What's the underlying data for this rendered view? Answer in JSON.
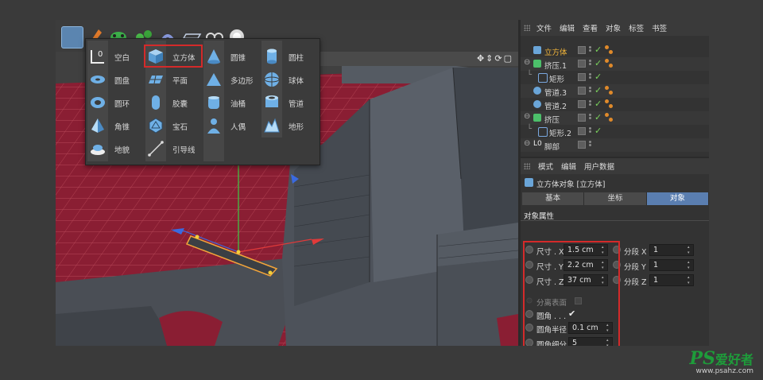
{
  "colors": {
    "highlight": "#d42a2a",
    "selected_text": "#f2b53a",
    "tab_active": "#5a7eb0",
    "floor": "#8a1e33",
    "check": "#7bd35c"
  },
  "object_menu": {
    "items": [
      {
        "label": "空白",
        "icon": "null-icon"
      },
      {
        "label": "立方体",
        "icon": "cube-icon"
      },
      {
        "label": "圆锥",
        "icon": "cone-icon"
      },
      {
        "label": "圆柱",
        "icon": "cylinder-icon"
      },
      {
        "label": "圆盘",
        "icon": "disc-icon"
      },
      {
        "label": "平面",
        "icon": "plane-icon"
      },
      {
        "label": "多边形",
        "icon": "polygon-icon"
      },
      {
        "label": "球体",
        "icon": "sphere-icon"
      },
      {
        "label": "圆环",
        "icon": "torus-icon"
      },
      {
        "label": "胶囊",
        "icon": "capsule-icon"
      },
      {
        "label": "油桶",
        "icon": "oil-tank-icon"
      },
      {
        "label": "管道",
        "icon": "tube-icon"
      },
      {
        "label": "角锥",
        "icon": "pyramid-icon"
      },
      {
        "label": "宝石",
        "icon": "platonic-icon"
      },
      {
        "label": "人偶",
        "icon": "figure-icon"
      },
      {
        "label": "地形",
        "icon": "landscape-icon"
      },
      {
        "label": "地貌",
        "icon": "relief-icon"
      },
      {
        "label": "引导线",
        "icon": "guide-icon"
      }
    ]
  },
  "object_manager": {
    "menu": [
      "文件",
      "编辑",
      "查看",
      "对象",
      "标签",
      "书签"
    ],
    "rows": [
      {
        "name": "立方体",
        "selected": true
      },
      {
        "name": "挤压.1",
        "selected": false
      },
      {
        "name": "矩形",
        "selected": false
      },
      {
        "name": "管道.3",
        "selected": false
      },
      {
        "name": "管道.2",
        "selected": false
      },
      {
        "name": "挤压",
        "selected": false
      },
      {
        "name": "矩形.2",
        "selected": false
      },
      {
        "name": "脚部",
        "selected": false
      }
    ]
  },
  "attributes": {
    "menu": [
      "模式",
      "编辑",
      "用户数据"
    ],
    "title": "立方体对象 [立方体]",
    "tabs": [
      "基本",
      "坐标",
      "对象"
    ],
    "active_tab": "对象",
    "section": "对象属性",
    "size_x_label": "尺寸 . X",
    "size_x": "1.5 cm",
    "size_y_label": "尺寸 . Y",
    "size_y": "2.2 cm",
    "size_z_label": "尺寸 . Z",
    "size_z": "37 cm",
    "seg_x_label": "分段 X",
    "seg_x": "1",
    "seg_y_label": "分段 Y",
    "seg_y": "1",
    "seg_z_label": "分段 Z",
    "seg_z": "1",
    "separate_label": "分离表面",
    "fillet_label": "圆角 . . .",
    "fillet_checked": "✔",
    "fillet_radius_label": "圆角半径",
    "fillet_radius": "0.1 cm",
    "fillet_sub_label": "圆角细分",
    "fillet_sub": "5"
  },
  "watermark": {
    "brand": "PS",
    "text": "爱好者",
    "url": "www.psahz.com"
  }
}
